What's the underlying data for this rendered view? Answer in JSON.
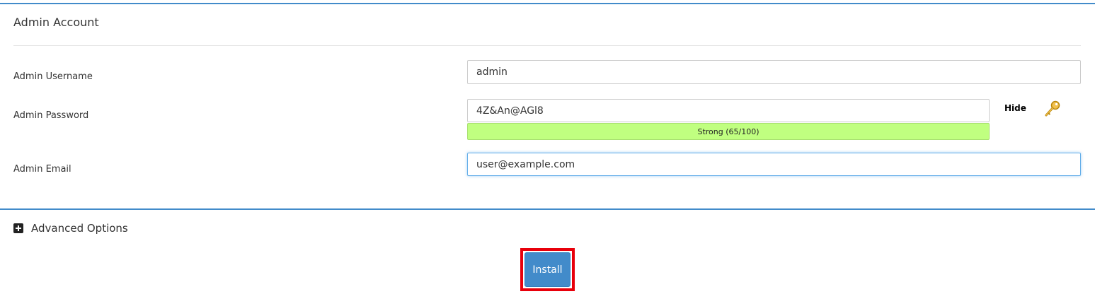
{
  "section": {
    "title": "Admin Account"
  },
  "fields": {
    "username": {
      "label": "Admin Username",
      "value": "admin"
    },
    "password": {
      "label": "Admin Password",
      "value": "4Z&An@AGl8",
      "strength_text": "Strong (65/100)",
      "strength_score": 65,
      "strength_color": "#c0ff80",
      "toggle_label": "Hide"
    },
    "email": {
      "label": "Admin Email",
      "value": "user@example.com"
    }
  },
  "advanced": {
    "label": "Advanced Options"
  },
  "install_button": {
    "label": "Install",
    "highlight_color": "#e8000b"
  },
  "colors": {
    "accent": "#428bca"
  },
  "icons": {
    "password_generator": "key-icon",
    "expand": "plus-square-icon"
  }
}
